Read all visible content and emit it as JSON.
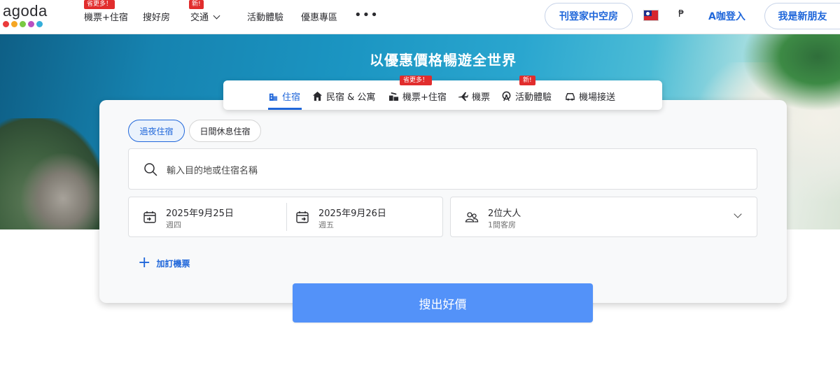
{
  "header": {
    "logo_text": "agoda",
    "logo_dot_colors": [
      "#ea3a3a",
      "#f5a623",
      "#7ac943",
      "#b84fc1",
      "#34aeda"
    ],
    "nav": [
      {
        "label": "機票+住宿",
        "badge": "省更多！"
      },
      {
        "label": "搜好房",
        "badge": ""
      },
      {
        "label": "交通",
        "badge": "新!"
      },
      {
        "label": "活動體驗",
        "badge": ""
      },
      {
        "label": "優惠專區",
        "badge": ""
      }
    ],
    "more_label": "•••",
    "list_property_label": "刊登家中空房",
    "currency_symbol": "₱",
    "login_label": "A咖登入",
    "signup_label": "我是新朋友",
    "flag_icon": "taiwan-flag-icon"
  },
  "hero": {
    "title": "以優惠價格暢遊全世界"
  },
  "tabs": [
    {
      "label": "住宿",
      "icon": "hotel-icon",
      "badge": ""
    },
    {
      "label": "民宿 & 公寓",
      "icon": "house-icon",
      "badge": ""
    },
    {
      "label": "機票+住宿",
      "icon": "flight-hotel-icon",
      "badge": "省更多！"
    },
    {
      "label": "機票",
      "icon": "airplane-icon",
      "badge": ""
    },
    {
      "label": "活動體驗",
      "icon": "ferris-wheel-icon",
      "badge": "新!"
    },
    {
      "label": "機場接送",
      "icon": "car-icon",
      "badge": ""
    }
  ],
  "search": {
    "stay_types": [
      "過夜住宿",
      "日間休息住宿"
    ],
    "destination_placeholder": "輸入目的地或住宿名稱",
    "checkin": {
      "date": "2025年9月25日",
      "weekday": "週四"
    },
    "checkout": {
      "date": "2025年9月26日",
      "weekday": "週五"
    },
    "guests": {
      "main": "2位大人",
      "sub": "1間客房"
    },
    "add_flight_label": "加訂機票",
    "button_label": "搜出好價"
  },
  "colors": {
    "accent": "#2067da",
    "search_button": "#5392f9",
    "badge": "#e12d2d"
  }
}
